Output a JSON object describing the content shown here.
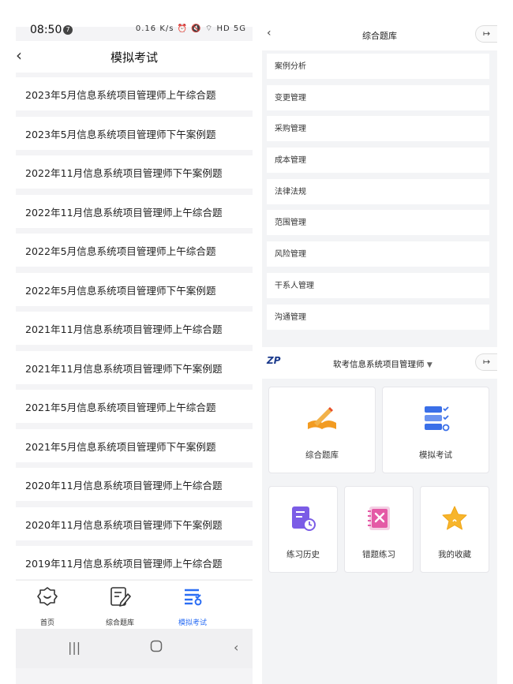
{
  "left": {
    "status": {
      "time": "08:50",
      "badge": "7",
      "icons": "0.16 K/s ⏰ 🔇 ⌔ HD 5G"
    },
    "header": {
      "back_icon": "chevron-left-icon",
      "title": "模拟考试"
    },
    "exams": [
      "2023年5月信息系统项目管理师上午综合题",
      "2023年5月信息系统项目管理师下午案例题",
      "2022年11月信息系统项目管理师下午案例题",
      "2022年11月信息系统项目管理师上午综合题",
      "2022年5月信息系统项目管理师上午综合题",
      "2022年5月信息系统项目管理师下午案例题",
      "2021年11月信息系统项目管理师上午综合题",
      "2021年11月信息系统项目管理师下午案例题",
      "2021年5月信息系统项目管理师上午综合题",
      "2021年5月信息系统项目管理师下午案例题",
      "2020年11月信息系统项目管理师上午综合题",
      "2020年11月信息系统项目管理师下午案例题",
      "2019年11月信息系统项目管理师上午综合题"
    ],
    "tabs": [
      {
        "label": "首页",
        "icon": "home-icon"
      },
      {
        "label": "综合题库",
        "icon": "edit-icon"
      },
      {
        "label": "模拟考试",
        "icon": "exam-list-icon"
      }
    ],
    "active_tab_color": "#2a6df4"
  },
  "right": {
    "header": {
      "title": "综合题库",
      "back_icon": "chevron-left-icon",
      "exit_icon": "exit-icon"
    },
    "categories": [
      "案例分析",
      "变更管理",
      "采购管理",
      "成本管理",
      "法律法规",
      "范围管理",
      "风险管理",
      "干系人管理",
      "沟通管理"
    ],
    "home": {
      "logo": "ZP",
      "subject": "软考信息系统项目管理师",
      "cards": [
        {
          "label": "综合题库",
          "icon": "book-pen-icon"
        },
        {
          "label": "模拟考试",
          "icon": "checklist-icon"
        },
        {
          "label": "练习历史",
          "icon": "history-icon"
        },
        {
          "label": "错题练习",
          "icon": "wrong-book-icon"
        },
        {
          "label": "我的收藏",
          "icon": "star-icon"
        }
      ]
    }
  }
}
